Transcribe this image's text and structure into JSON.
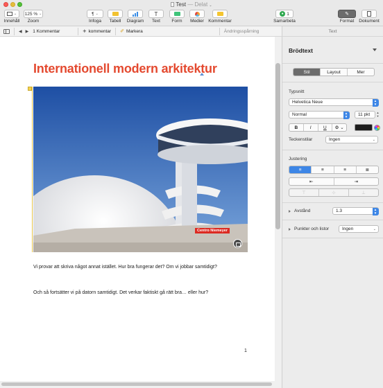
{
  "window": {
    "title": "Test",
    "shared_label": "— Delat"
  },
  "toolbar": {
    "view_label": "Innehåll",
    "zoom_value": "125 %",
    "zoom_label": "Zoom",
    "insert_label": "Infoga",
    "table_label": "Tabell",
    "chart_label": "Diagram",
    "text_label": "Text",
    "shape_label": "Form",
    "media_label": "Medier",
    "comment_label": "Kommentar",
    "collaborate_count": "1",
    "collaborate_label": "Samarbeta",
    "format_label": "Format",
    "document_label": "Dokument",
    "insert_glyph": "¶"
  },
  "subbar": {
    "comments_count": "1 Kommentar",
    "add_comment": "kommentar",
    "highlight": "Markera",
    "track_changes": "Ändringsspårning",
    "pane_title": "Text"
  },
  "document": {
    "title": "Internationell modern arkitektur",
    "image_caption": "Centro Niemeyer",
    "paragraph1": "Vi provar att skriva något annat istället. Hur bra fungerar det? Om vi jobbar samtidigt?",
    "paragraph2": "Och så fortsätter vi på datorn samtidigt. Det verkar faktiskt gå rätt bra… eller hur?",
    "page_number": "1"
  },
  "inspector": {
    "paragraph_style": "Brödtext",
    "tabs": [
      "Stil",
      "Layout",
      "Mer"
    ],
    "active_tab": "Stil",
    "font_section": "Typsnitt",
    "font_family": "Helvetica Neue",
    "font_weight": "Normal",
    "font_size": "11 pkt",
    "bold": "B",
    "italic": "I",
    "underline": "U",
    "char_styles_label": "Teckenstilar",
    "char_style_value": "Ingen",
    "alignment_label": "Justering",
    "spacing_label": "Avstånd",
    "spacing_value": "1.3",
    "bullets_label": "Punkter och listor",
    "bullets_value": "Ingen"
  },
  "colors": {
    "title_red": "#e4492f",
    "accent_blue": "#3d86e6",
    "badge_red": "#dc2a22"
  }
}
